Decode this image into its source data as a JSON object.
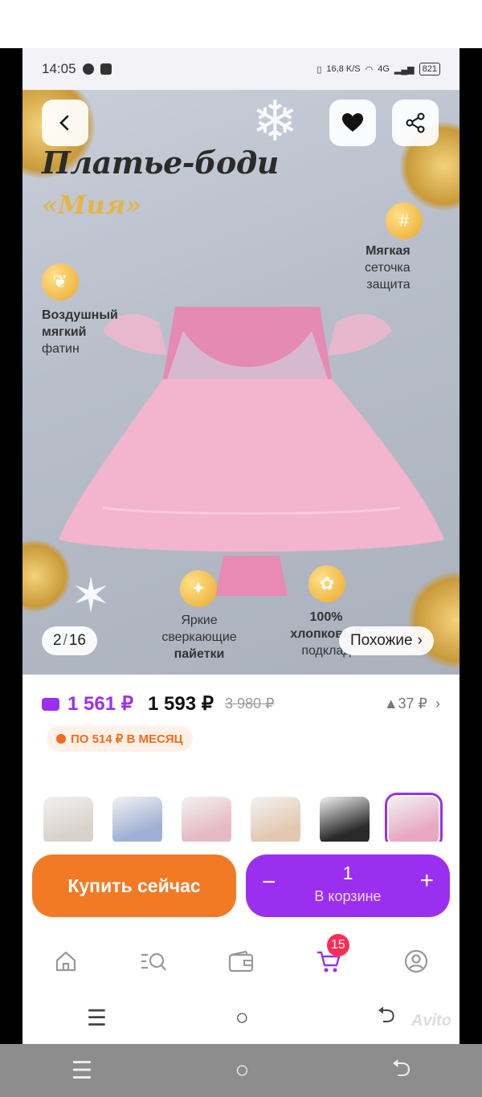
{
  "status_bar": {
    "time": "14:05",
    "net_speed": "16,8",
    "net_unit": "K/S",
    "signal": "4G",
    "battery": "821"
  },
  "hero": {
    "title": "Платье-боди",
    "subtitle": "«Мия»",
    "features": {
      "mesh": [
        "Мягкая",
        "сеточка",
        "защита"
      ],
      "tulle": [
        "Воздушный",
        "мягкий",
        "фатин"
      ],
      "sequins": [
        "Яркие",
        "сверкающие",
        "пайетки"
      ],
      "cotton": [
        "100%",
        "хлопковый",
        "подклад"
      ]
    },
    "counter": {
      "current": "2",
      "total": "16"
    },
    "similar_label": "Похожие"
  },
  "price": {
    "wallet_price": "1 561 ₽",
    "price": "1 593 ₽",
    "old_price": "3 980 ₽",
    "diff": "▲37 ₽",
    "monthly": "ПО 514 ₽ В МЕСЯЦ"
  },
  "thumbnails": [
    {
      "color": "#d9d2cc"
    },
    {
      "color": "#9fb0d4"
    },
    {
      "color": "#e6b9c4"
    },
    {
      "color": "#e3c8b0"
    },
    {
      "color": "#2a2a2a"
    },
    {
      "color": "#e7a8c1"
    }
  ],
  "actions": {
    "buy_now": "Купить сейчас",
    "cart_qty": "1",
    "cart_label": "В корзине",
    "minus": "−",
    "plus": "+"
  },
  "tabbar": {
    "cart_badge": "15"
  },
  "watermark": "Avito",
  "colors": {
    "accent": "#9b2ff0",
    "buy": "#f27a25",
    "badge": "#ff2d55"
  }
}
